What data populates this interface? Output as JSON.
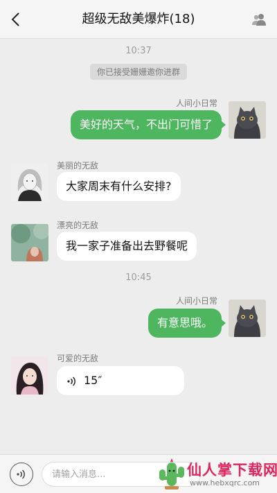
{
  "header": {
    "title": "超级无敌美爆炸(18)",
    "back_icon": "chevron-left-icon",
    "group_icon": "group-members-icon"
  },
  "chat": {
    "time_1": "10:37",
    "system_notice": "你已接受姗姗邀你进群",
    "time_2": "10:45",
    "messages": [
      {
        "side": "right",
        "sender": "人间小日常",
        "text": "美好的天气，不出门可惜了",
        "avatar": "cat-avatar"
      },
      {
        "side": "left",
        "sender": "美丽的无敌",
        "text": "大家周末有什么安排?",
        "avatar": "girl-avatar-bw"
      },
      {
        "side": "left",
        "sender": "漂亮的无敌",
        "text": "我一家子准备出去野餐呢",
        "avatar": "girl-avatar-green"
      },
      {
        "side": "right",
        "sender": "人间小日常",
        "text": "有意思哦。",
        "avatar": "cat-avatar"
      },
      {
        "side": "left",
        "sender": "可爱的无敌",
        "text": "15″",
        "type": "voice",
        "avatar": "girl-avatar-pink"
      }
    ]
  },
  "input_bar": {
    "voice_icon": "voice-mode-icon",
    "placeholder": "请输入消息...",
    "value": ""
  },
  "watermark": {
    "title": "仙人掌下载网",
    "url": "www.hebxqrc.com"
  },
  "colors": {
    "green_bubble": "#4db65e",
    "background": "#ededed",
    "watermark_red": "#e0245e"
  }
}
